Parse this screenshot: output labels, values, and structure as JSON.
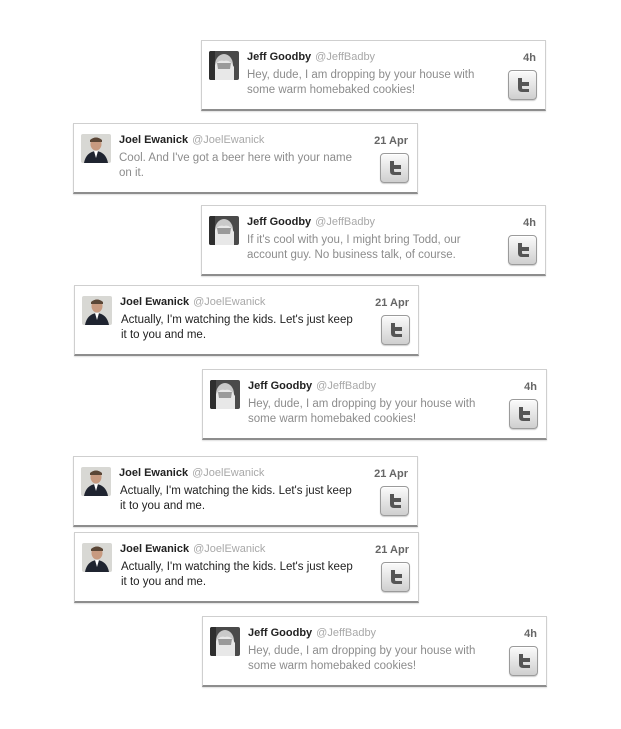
{
  "tweets": [
    {
      "author": "Jeff Goodby",
      "handle": "@JeffBadby",
      "time": "4h",
      "text": "Hey, dude, I am dropping by your house with some warm homebaked cookies!"
    },
    {
      "author": "Joel Ewanick",
      "handle": "@JoelEwanick",
      "time": "21 Apr",
      "text": "Cool.  And I've got a beer here with your name on it."
    },
    {
      "author": "Jeff Goodby",
      "handle": "@JeffBadby",
      "time": "4h",
      "text": "If it's cool with you, I might bring Todd, our account guy.  No business talk, of course."
    },
    {
      "author": "Joel Ewanick",
      "handle": "@JoelEwanick",
      "time": "21 Apr",
      "text": "Actually, I'm watching the kids.  Let's just keep it to you and me."
    },
    {
      "author": "Jeff Goodby",
      "handle": "@JeffBadby",
      "time": "4h",
      "text": "Hey, dude, I am dropping by your house with some warm homebaked cookies!"
    },
    {
      "author": "Joel Ewanick",
      "handle": "@JoelEwanick",
      "time": "21 Apr",
      "text": "Actually, I'm watching the kids.  Let's just keep it to you and me."
    },
    {
      "author": "Joel Ewanick",
      "handle": "@JoelEwanick",
      "time": "21 Apr",
      "text": "Actually, I'm watching the kids.  Let's just keep it to you and me."
    },
    {
      "author": "Jeff Goodby",
      "handle": "@JeffBadby",
      "time": "4h",
      "text": "Hey, dude, I am dropping by your house with some warm homebaked cookies!"
    }
  ],
  "icons": {
    "button": "twitter-bird-icon",
    "jeff_avatar": "face-palm-avatar",
    "joel_avatar": "portrait-suit-avatar"
  }
}
